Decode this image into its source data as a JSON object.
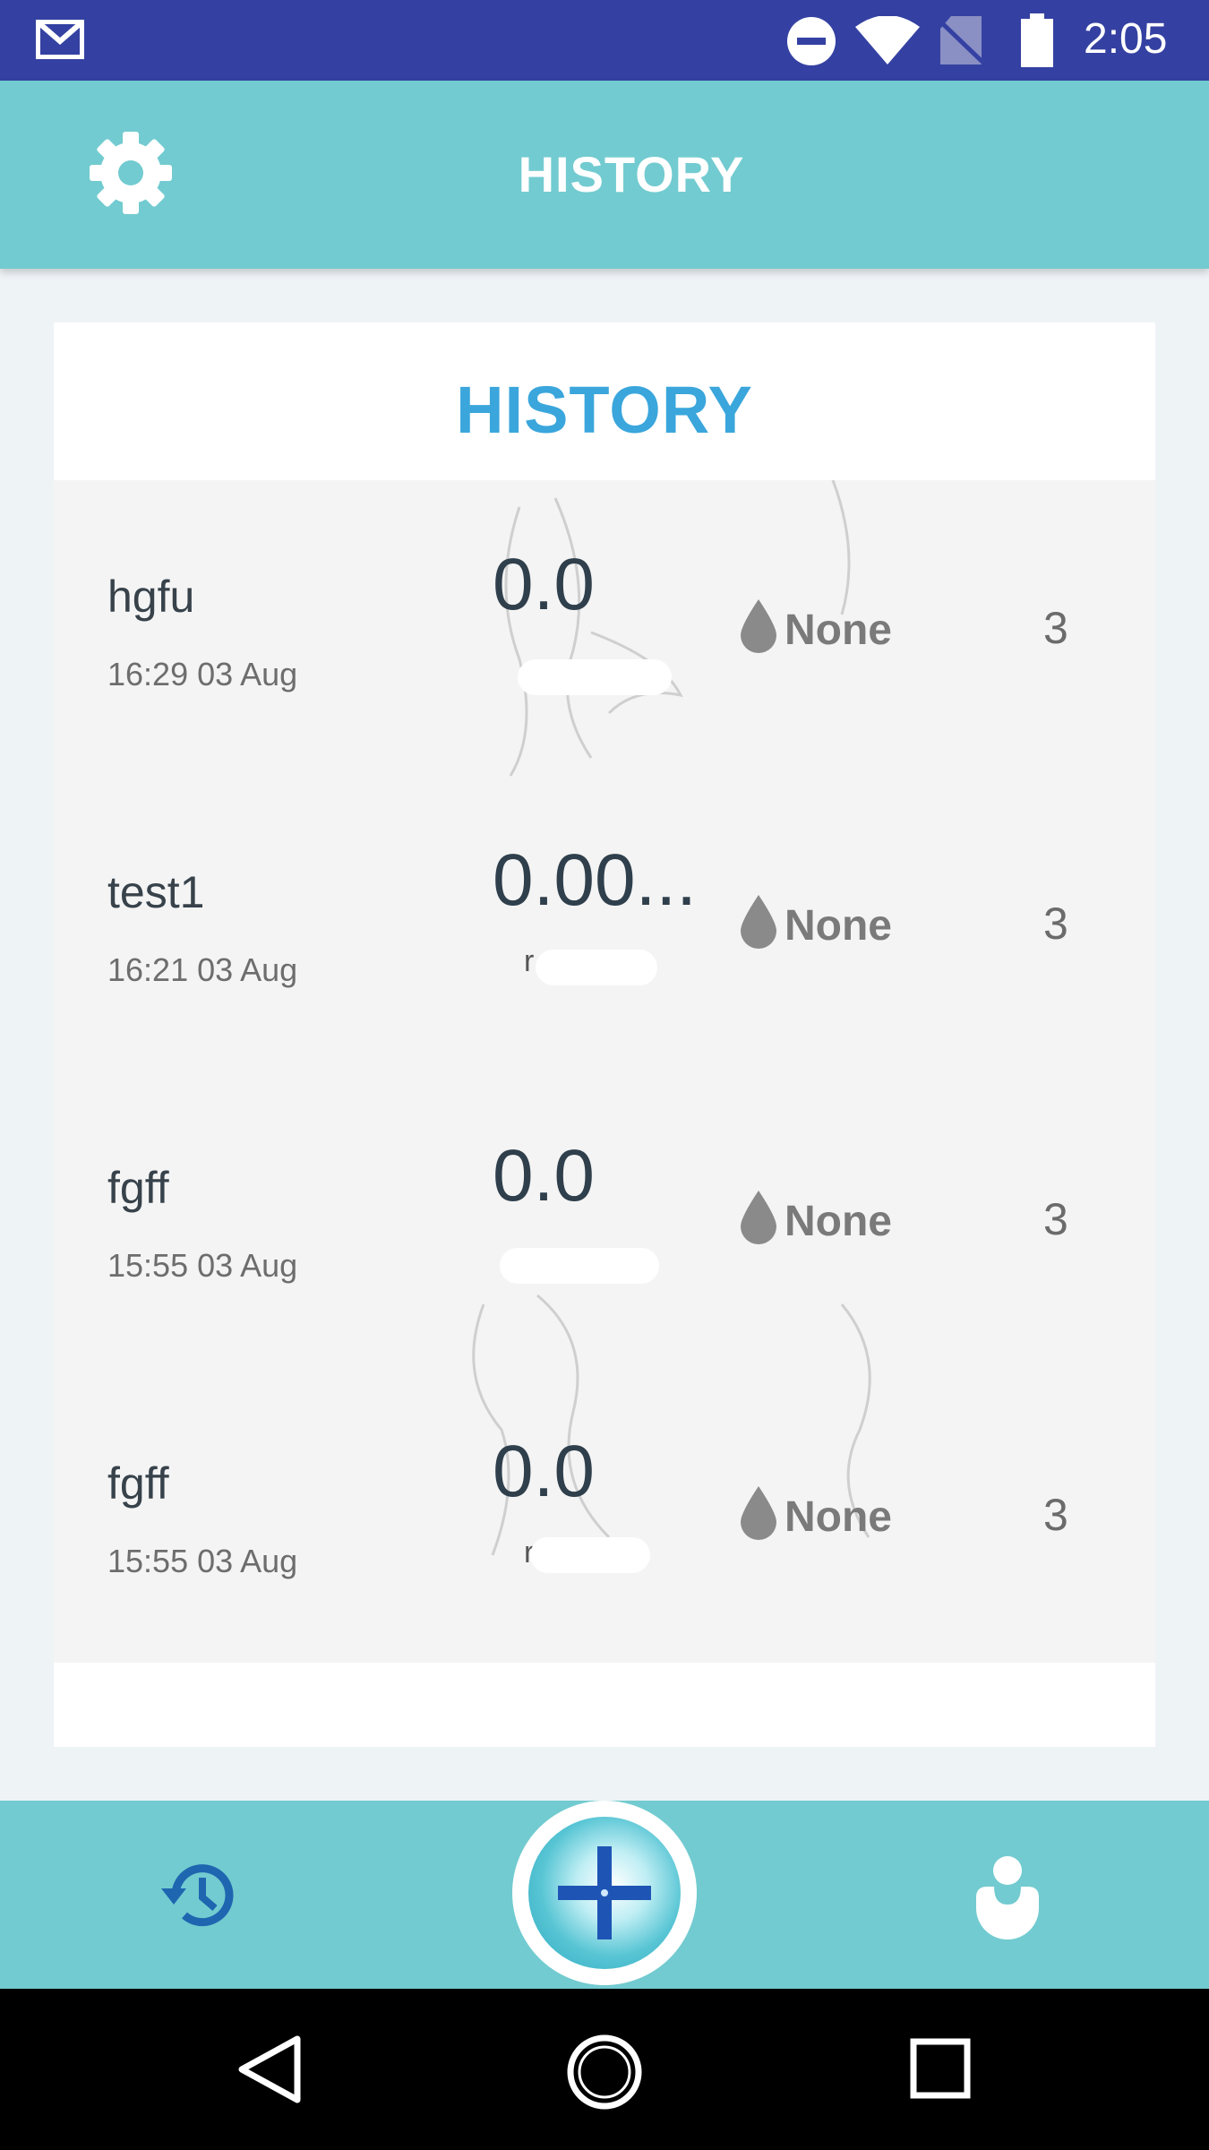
{
  "status_bar": {
    "time": "2:05",
    "icons": [
      "gmail-icon",
      "do-not-disturb-icon",
      "wifi-icon",
      "no-sim-icon",
      "battery-icon"
    ]
  },
  "app_bar": {
    "title": "HISTORY",
    "settings_icon": "gear-icon"
  },
  "card": {
    "title": "HISTORY"
  },
  "history": [
    {
      "name": "hgfu",
      "date": "16:29  03 Aug",
      "value": "0.0",
      "unit": "",
      "type": "None",
      "count": "3"
    },
    {
      "name": "test1",
      "date": "16:21  03 Aug",
      "value": "0.00...",
      "unit": "r",
      "type": "None",
      "count": "3"
    },
    {
      "name": "fgff",
      "date": "15:55  03 Aug",
      "value": "0.0",
      "unit": "",
      "type": "None",
      "count": "3"
    },
    {
      "name": "fgff",
      "date": "15:55  03 Aug",
      "value": "0.0",
      "unit": "r",
      "type": "None",
      "count": "3"
    }
  ],
  "bottom_nav": {
    "items": [
      "history-icon",
      "add-icon",
      "profile-icon"
    ]
  },
  "system_nav": {
    "items": [
      "back-icon",
      "home-icon",
      "recents-icon"
    ]
  },
  "colors": {
    "status_bar": "#3441a2",
    "app_bar": "#72cbd0",
    "card_title": "#3aa6dc",
    "nav_icon": "#1e66b0"
  }
}
